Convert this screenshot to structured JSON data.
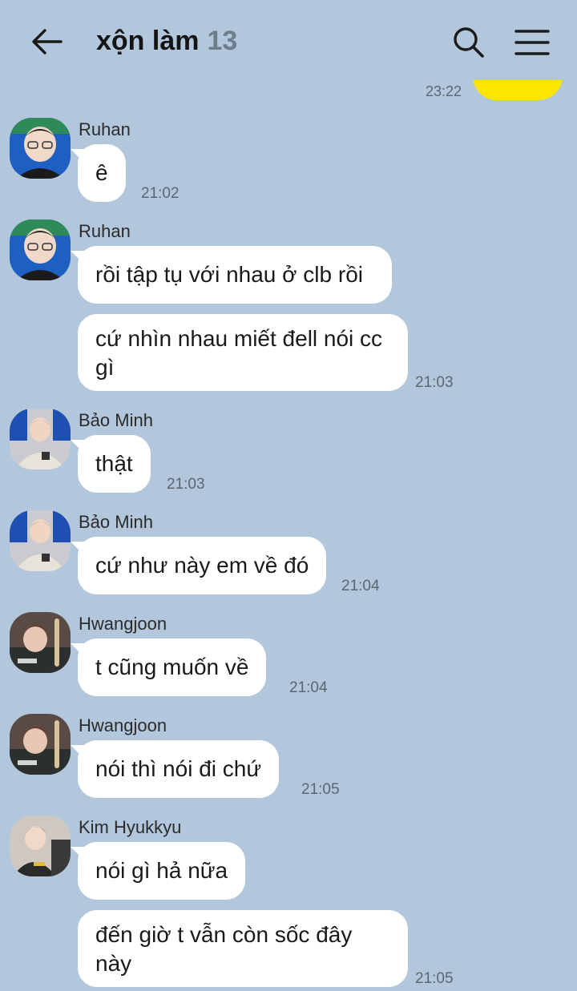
{
  "header": {
    "title": "xộn làm",
    "member_count": "13",
    "back_icon": "arrow-left-icon",
    "search_icon": "search-icon",
    "menu_icon": "hamburger-menu-icon"
  },
  "previous_message": {
    "time": "23:22"
  },
  "colors": {
    "background": "#b2c7dc",
    "own_bubble": "#fee500",
    "other_bubble": "#ffffff"
  },
  "messages": [
    {
      "sender": "Ruhan",
      "bubbles": [
        "ê"
      ],
      "time": "21:02"
    },
    {
      "sender": "Ruhan",
      "bubbles": [
        "rồi tập tụ với nhau ở clb rồi",
        "cứ nhìn nhau miết đell nói cc gì"
      ],
      "time": "21:03"
    },
    {
      "sender": "Bảo Minh",
      "bubbles": [
        "thật"
      ],
      "time": "21:03"
    },
    {
      "sender": "Bảo Minh",
      "bubbles": [
        "cứ như này em về đó"
      ],
      "time": "21:04"
    },
    {
      "sender": "Hwangjoon",
      "bubbles": [
        "t cũng muốn về"
      ],
      "time": "21:04"
    },
    {
      "sender": "Hwangjoon",
      "bubbles": [
        "nói thì nói đi chứ"
      ],
      "time": "21:05"
    },
    {
      "sender": "Kim Hyukkyu",
      "bubbles": [
        "nói gì hả nữa",
        "đến giờ t vẫn còn sốc đây này"
      ],
      "time": "21:05"
    }
  ]
}
